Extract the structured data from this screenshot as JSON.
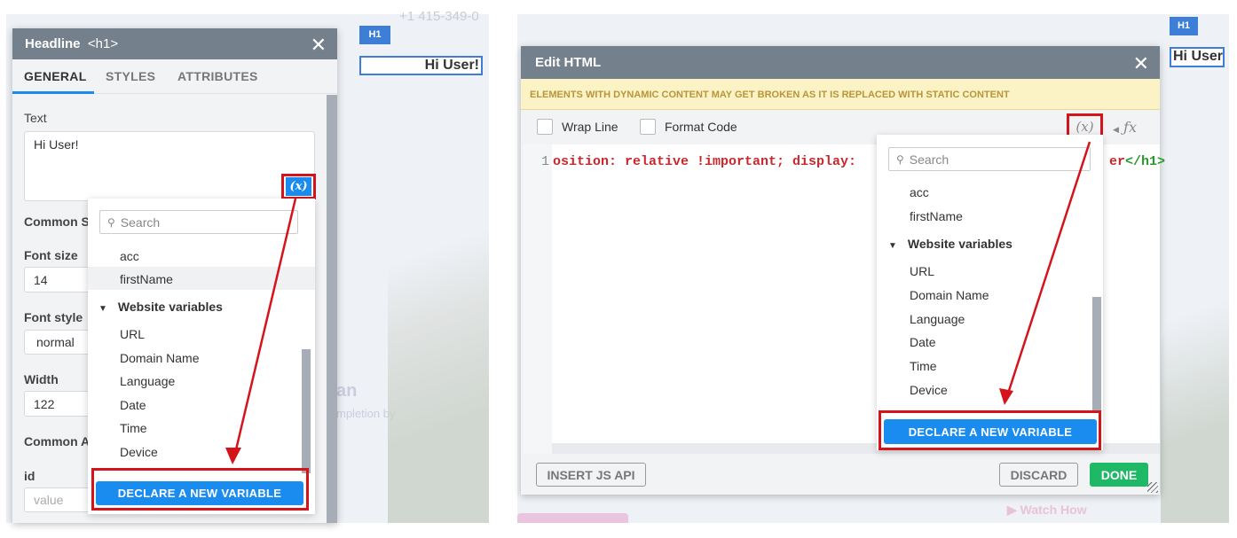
{
  "left": {
    "bg_phone": "+1 415-349-0",
    "h1_tag": "H1",
    "preview_text": "Hi User!",
    "faded_an": "an",
    "faded_completion": "mpletion by",
    "panel": {
      "title": "Headline",
      "tag": "<h1>",
      "close": "✕",
      "tabs": [
        "GENERAL",
        "STYLES",
        "ATTRIBUTES"
      ],
      "active_tab": "GENERAL",
      "text_label": "Text",
      "text_value": "Hi User!",
      "var_button": "(x)",
      "common_styles": "Common S",
      "font_size_label": "Font size",
      "font_size": "14",
      "font_style_label": "Font style",
      "font_style": "normal",
      "width_label": "Width",
      "width": "122",
      "common_attrs": "Common A",
      "id_label": "id",
      "id_placeholder": "value"
    },
    "dropdown": {
      "search_placeholder": "Search",
      "items": [
        "acc",
        "firstName"
      ],
      "group": "Website variables",
      "group_items": [
        "URL",
        "Domain Name",
        "Language",
        "Date",
        "Time",
        "Device"
      ],
      "declare": "DECLARE A NEW VARIABLE"
    }
  },
  "right": {
    "h1_tag": "H1",
    "preview_text": "Hi User",
    "watch_how": "Watch How",
    "modal": {
      "title": "Edit HTML",
      "close": "✕",
      "warning": "ELEMENTS WITH DYNAMIC CONTENT MAY GET BROKEN AS IT IS REPLACED WITH STATIC CONTENT",
      "wrap_line": "Wrap Line",
      "format_code": "Format Code",
      "var_button": "(x)",
      "fx_button": "ƒx",
      "line_number": "1",
      "code_left": "osition: relative !important; display:",
      "code_right_a": "er",
      "code_right_b": "</h1>",
      "insert_js": "INSERT JS API",
      "discard": "DISCARD",
      "done": "DONE"
    },
    "dropdown": {
      "search_placeholder": "Search",
      "items": [
        "acc",
        "firstName"
      ],
      "group": "Website variables",
      "group_items": [
        "URL",
        "Domain Name",
        "Language",
        "Date",
        "Time",
        "Device"
      ],
      "declare": "DECLARE A NEW VARIABLE"
    }
  },
  "colors": {
    "accent": "#1a8cf0",
    "highlight": "#d4141a",
    "done": "#1fb866",
    "header": "#75808d",
    "warning_bg": "#fbf3c6"
  }
}
